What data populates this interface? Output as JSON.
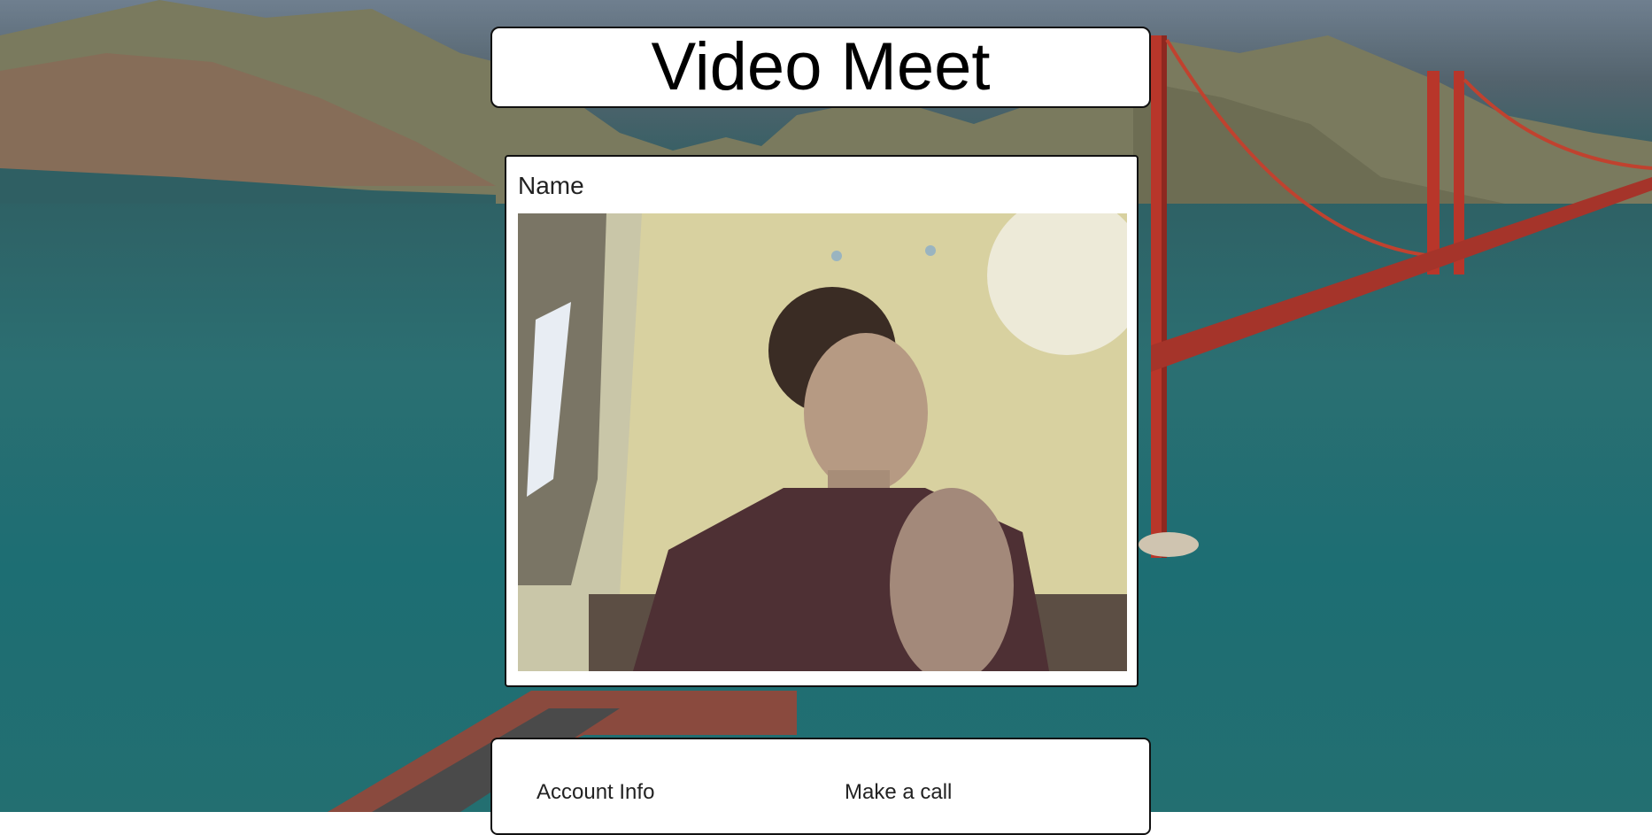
{
  "app": {
    "title": "Video Meet"
  },
  "video": {
    "participant_label": "Name"
  },
  "bottom_nav": {
    "items": [
      {
        "label": "Account Info"
      },
      {
        "label": "Make a call"
      }
    ]
  },
  "colors": {
    "panel_background": "#ffffff",
    "panel_border": "#111111",
    "sea": "#236f71",
    "bridge": "#b8362a"
  }
}
